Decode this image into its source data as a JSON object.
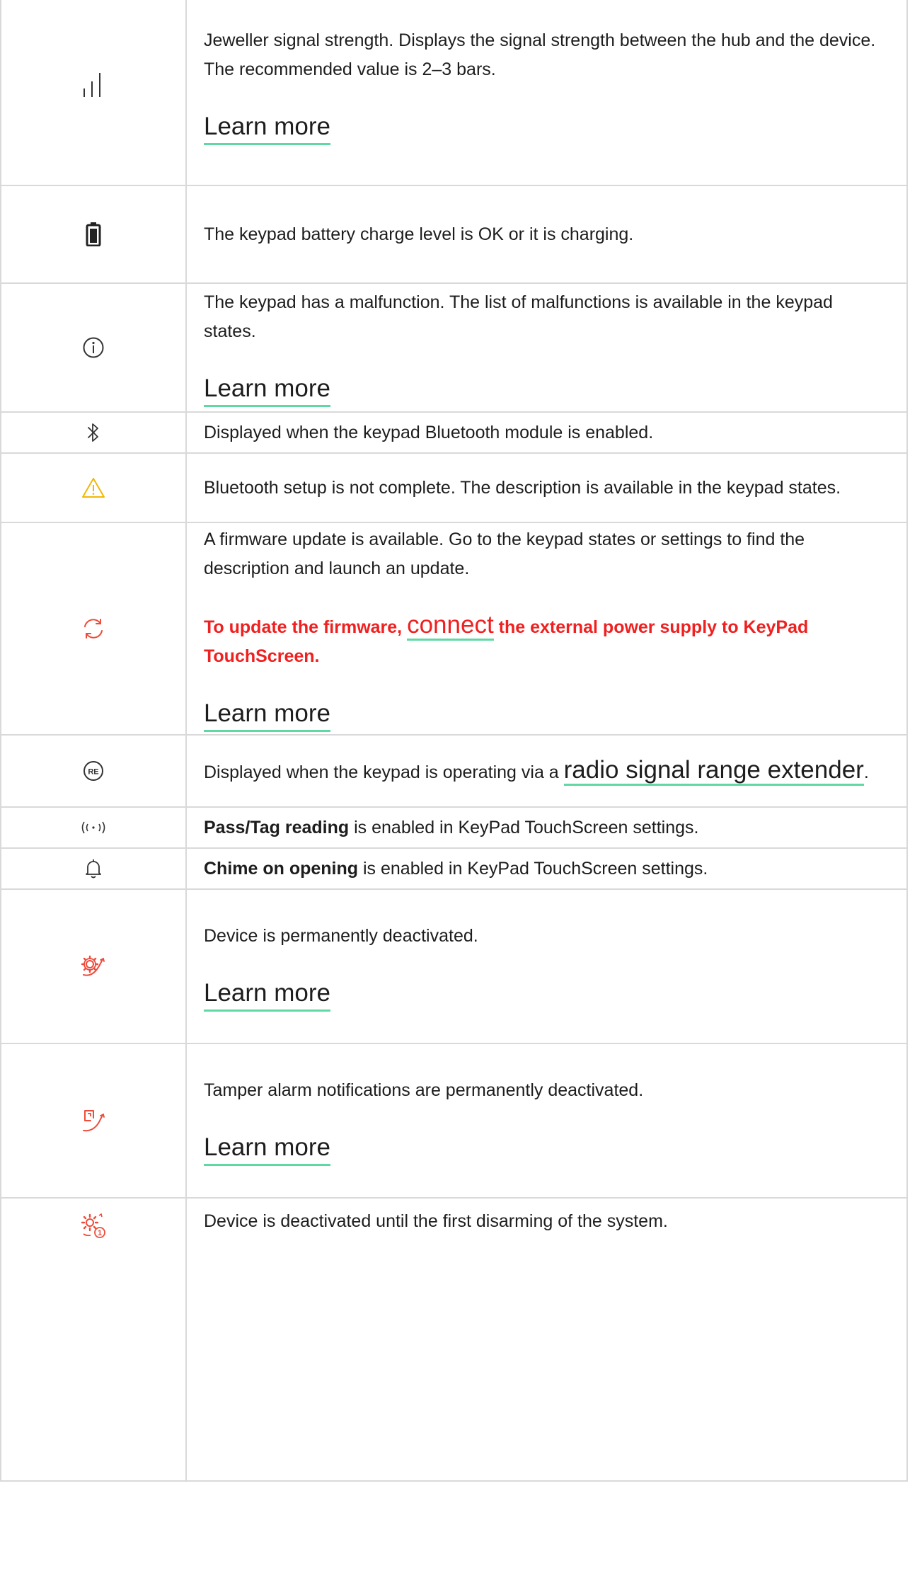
{
  "colors": {
    "accent_underline": "#5fd8a4",
    "warning_red": "#f02020",
    "icon_red": "#ee4b3a",
    "icon_yellow": "#f2b705",
    "border": "#d9d9d9"
  },
  "rows": [
    {
      "icon": "signal-strength-icon",
      "text": "Jeweller signal strength. Displays the signal strength between the hub and the device. The recommended value is 2–3 bars.",
      "link": "Learn more"
    },
    {
      "icon": "battery-icon",
      "text": "The keypad battery charge level is OK or it is charging."
    },
    {
      "icon": "info-icon",
      "text": "The keypad has a malfunction. The list of malfunctions is available in the keypad states.",
      "link": "Learn more"
    },
    {
      "icon": "bluetooth-icon",
      "text": "Displayed when the keypad Bluetooth module is enabled."
    },
    {
      "icon": "warning-icon",
      "text": "Bluetooth setup is not complete. The description is available in the keypad states."
    },
    {
      "icon": "firmware-update-icon",
      "text": "A firmware update is available. Go to the keypad states or settings to find the description and launch an update.",
      "warning_pre": "To update the firmware,",
      "warning_link": "connect",
      "warning_post": "the external power supply to KeyPad TouchScreen.",
      "link": "Learn more"
    },
    {
      "icon": "range-extender-icon",
      "text_pre": "Displayed when the keypad is operating via a",
      "text_link": "radio signal range extender",
      "text_post": "."
    },
    {
      "icon": "pass-tag-icon",
      "bold": "Pass/Tag reading",
      "text": "is enabled in KeyPad TouchScreen settings."
    },
    {
      "icon": "bell-icon",
      "bold": "Chime on opening",
      "text": "is enabled in KeyPad TouchScreen settings."
    },
    {
      "icon": "device-deactivated-icon",
      "text": "Device is permanently deactivated.",
      "link": "Learn more"
    },
    {
      "icon": "tamper-deactivated-icon",
      "text": "Tamper alarm notifications are permanently deactivated.",
      "link": "Learn more"
    },
    {
      "icon": "deactivated-until-disarm-icon",
      "text": "Device is deactivated until the first disarming of the system."
    }
  ]
}
